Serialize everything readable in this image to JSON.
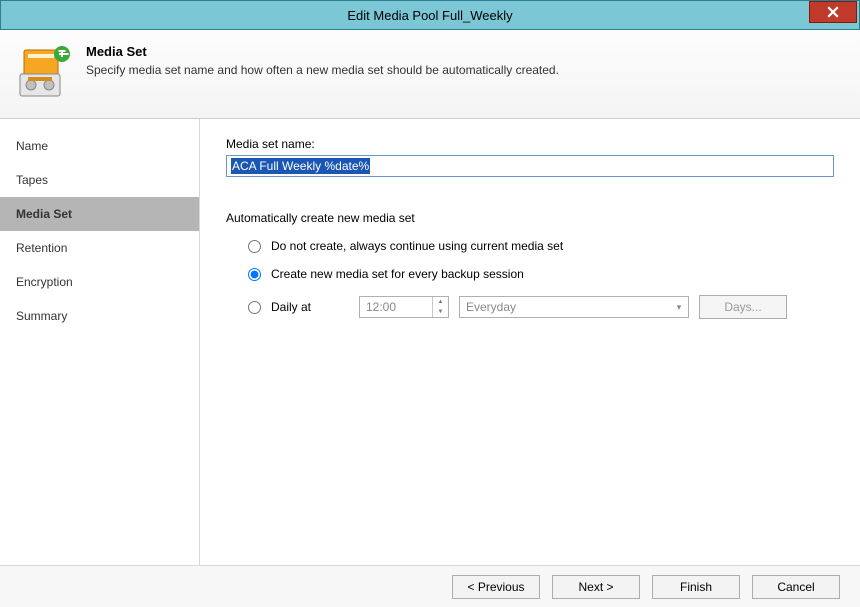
{
  "window": {
    "title": "Edit Media Pool Full_Weekly"
  },
  "header": {
    "title": "Media Set",
    "description": "Specify media set name and how often a new media set should be automatically created."
  },
  "sidebar": {
    "items": [
      {
        "label": "Name"
      },
      {
        "label": "Tapes"
      },
      {
        "label": "Media Set"
      },
      {
        "label": "Retention"
      },
      {
        "label": "Encryption"
      },
      {
        "label": "Summary"
      }
    ],
    "activeIndex": 2
  },
  "form": {
    "nameLabel": "Media set name:",
    "nameValue": "ACA Full Weekly %date%",
    "autoSection": "Automatically create new media set",
    "options": {
      "doNotCreate": "Do not create, always continue using current media set",
      "perSession": "Create new media set for every backup session",
      "dailyAt": "Daily at"
    },
    "selected": "perSession",
    "daily": {
      "time": "12:00",
      "frequency": "Everyday",
      "daysBtn": "Days..."
    }
  },
  "buttons": {
    "previous": "< Previous",
    "next": "Next >",
    "finish": "Finish",
    "cancel": "Cancel"
  }
}
